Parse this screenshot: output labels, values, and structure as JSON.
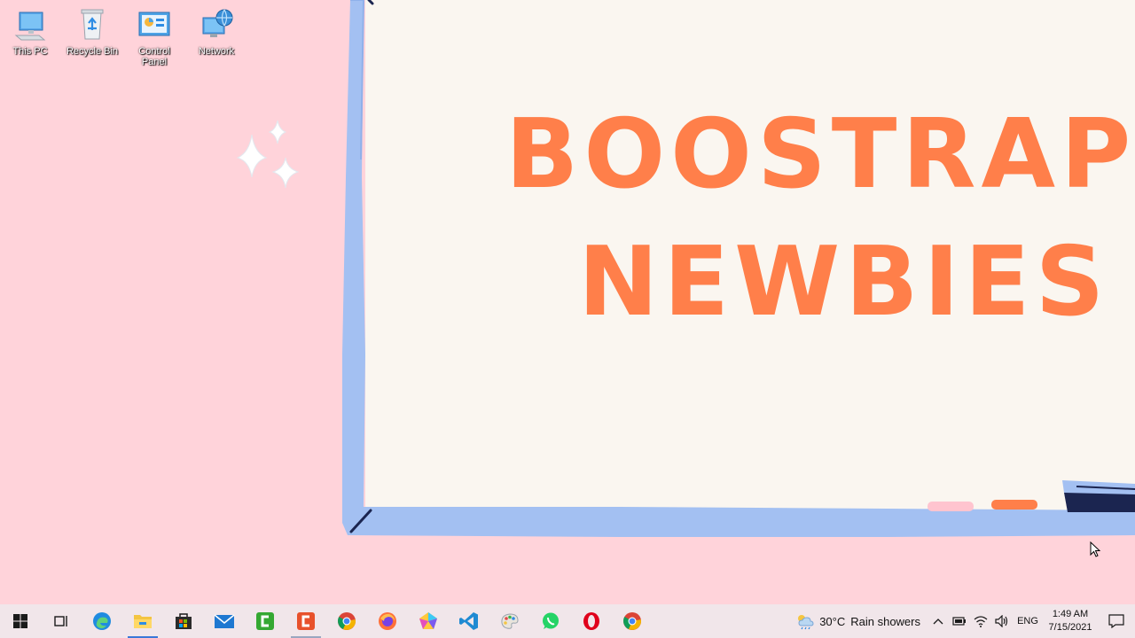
{
  "desktop": {
    "icons": [
      {
        "label": "This PC",
        "icon": "this-pc-icon"
      },
      {
        "label": "Recycle Bin",
        "icon": "recycle-bin-icon"
      },
      {
        "label": "Control Panel",
        "icon": "control-panel-icon"
      },
      {
        "label": "Network",
        "icon": "network-icon"
      }
    ]
  },
  "wallpaper": {
    "line1": "BOOSTRAP",
    "line2": "NEWBIES",
    "colors": {
      "background": "#ffd3da",
      "board": "#faf6f0",
      "frame": "#a3c0f2",
      "text": "#ff7f4a"
    }
  },
  "taskbar": {
    "apps": [
      "start-icon",
      "task-view-icon",
      "edge-icon",
      "file-explorer-icon",
      "store-icon",
      "mail-icon",
      "camtasia-icon",
      "office-icon",
      "chrome-icon",
      "firefox-icon",
      "polypane-icon",
      "vscode-icon",
      "paint-icon",
      "whatsapp-icon",
      "opera-icon",
      "chrome-icon"
    ],
    "weather": {
      "temp": "30°C",
      "condition": "Rain showers"
    },
    "language": "ENG",
    "clock": {
      "time": "1:49 AM",
      "date": "7/15/2021"
    }
  }
}
